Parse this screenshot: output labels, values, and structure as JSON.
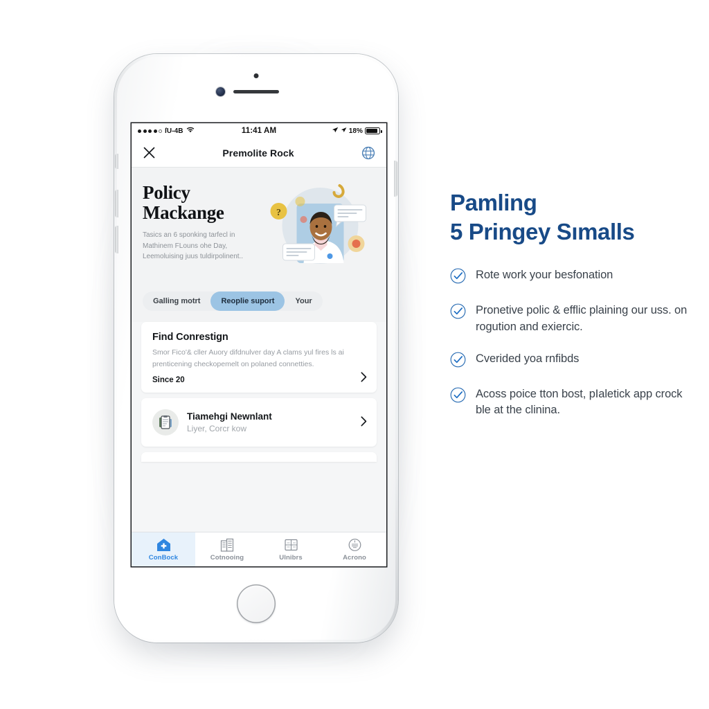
{
  "phone": {
    "status_bar": {
      "carrier": "ſU-4B",
      "time": "11:41 AM",
      "battery_pct": "18%",
      "wifi_icon": "wifi-icon",
      "location_icon": "location-arrow-icon",
      "signal_icon": "signal-dots-icon",
      "battery_icon": "battery-icon"
    },
    "nav": {
      "close_icon": "close-icon",
      "title": "Premolite Rock",
      "globe_icon": "globe-icon"
    },
    "hero": {
      "title_line1": "Policy",
      "title_line2": "Mackange",
      "body": "Tasics an 6 sponking tarfecl in Mathinem FLouns ohe Day, Leemoluising juus tuldirpolinent..",
      "illustration_icon": "doctor-illustration"
    },
    "chips": [
      {
        "label": "Galling motrt",
        "active": false
      },
      {
        "label": "Reoplie suport",
        "active": true
      },
      {
        "label": "Your",
        "active": false
      }
    ],
    "cards": [
      {
        "type": "text",
        "title": "Find Conrestign",
        "body": "Smor Fico'& cller Auory difdnulver day A clams yul fires ls ai prenticening checkopemelt on polaned connetties.",
        "meta": "Since 20",
        "chevron_icon": "chevron-right-icon"
      },
      {
        "type": "row",
        "icon": "clipboard-document-icon",
        "title": "Tiamehgi Newnlant",
        "subtitle": "Liyer, Corcr kow",
        "chevron_icon": "chevron-right-icon"
      }
    ],
    "tabs": [
      {
        "label": "ConBock",
        "icon": "hospital-home-icon",
        "active": true
      },
      {
        "label": "Cotnooing",
        "icon": "buildings-icon",
        "active": false
      },
      {
        "label": "Ulnibrs",
        "icon": "grid-window-icon",
        "active": false
      },
      {
        "label": "Acrono",
        "icon": "circle-badge-icon",
        "active": false
      }
    ]
  },
  "panel": {
    "heading_line1": "Pamling",
    "heading_line2": "5 Pringey Sımalls",
    "bullets": [
      {
        "text": "Rote work your besfonation",
        "icon": "check-circle-icon"
      },
      {
        "text": "Pronetive polic & efflic plaining our uss. on rogution and exiercic.",
        "icon": "check-circle-icon"
      },
      {
        "text": "Cverided yoa rnfibds",
        "icon": "check-circle-icon"
      },
      {
        "text": "Acoss poice tton bost, pIaletick app crock ble at the clinina.",
        "icon": "check-circle-icon"
      }
    ]
  },
  "colors": {
    "panel_heading": "#184a87",
    "check_blue": "#1f6fc4",
    "chip_active": "#9cc4e4",
    "tab_active": "#2f86e0",
    "tab_active_bg": "#e8f2fb"
  }
}
